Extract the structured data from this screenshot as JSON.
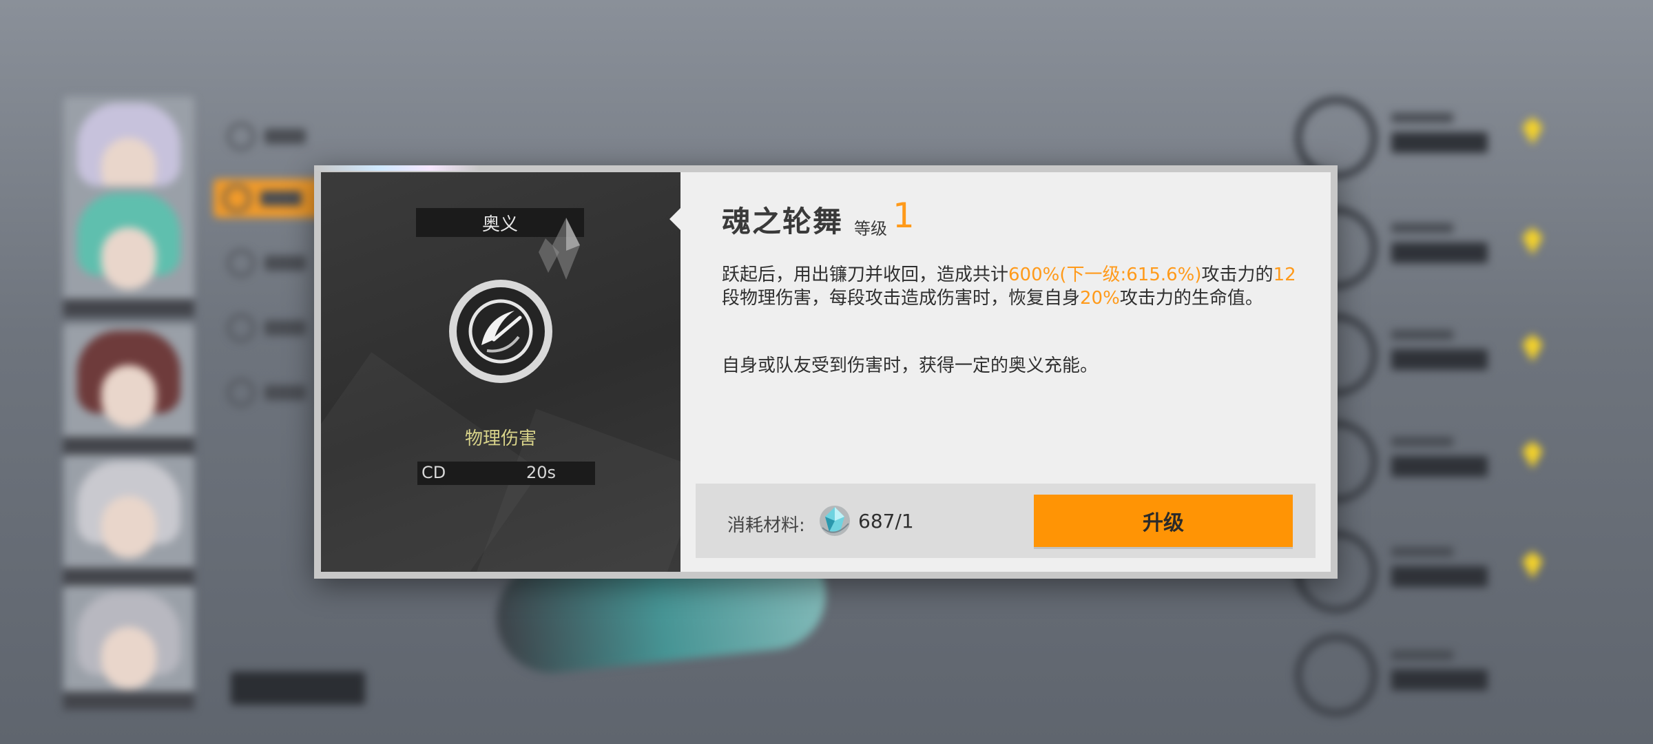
{
  "skill": {
    "category": "奥义",
    "name": "魂之轮舞",
    "level_label": "等级",
    "level": "1",
    "damage_type": "物理伤害",
    "cd_label": "CD",
    "cd_value": "20s",
    "description_1": {
      "p1": "跃起后，用出镰刀并收回，造成共计",
      "hl1": "600%(下一级:615.6%)",
      "p2": "攻击力的",
      "hl2": "12",
      "p3": "段物理伤害，每段攻击造成伤害时，恢复自身",
      "hl3": "20%",
      "p4": "攻击力的生命值。"
    },
    "description_2": "自身或队友受到伤害时，获得一定的奥义充能。"
  },
  "cost": {
    "label": "消耗材料:",
    "material_icon": "crystal-material-icon",
    "count": "687/1"
  },
  "upgrade_button_label": "升级",
  "colors": {
    "accent": "#ff9405",
    "highlight_text": "#ff9a1a",
    "damage_type": "#d8d38a"
  }
}
